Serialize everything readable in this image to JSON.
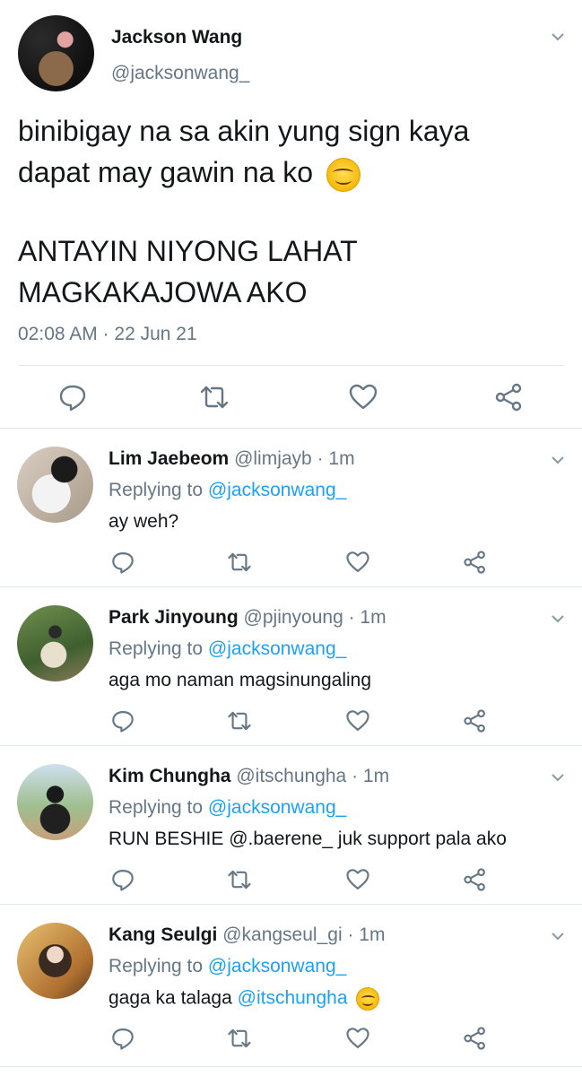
{
  "main_tweet": {
    "name": "Jackson Wang",
    "handle": "@jacksonwang_",
    "text_line1": "binibigay na sa akin yung sign kaya",
    "text_line2": "dapat may gawin na ko",
    "text_line3": "ANTAYIN NIYONG LAHAT",
    "text_line4": "MAGKAKAJOWA AKO",
    "timestamp": "02:08 AM · 22 Jun 21",
    "emoji": "smiling-face-emoji"
  },
  "replies": [
    {
      "name": "Lim Jaebeom",
      "meta": "@limjayb · 1m",
      "replying_prefix": "Replying to ",
      "replying_handle": "@jacksonwang_",
      "text": "ay weh?",
      "mention": "",
      "emoji": ""
    },
    {
      "name": "Park Jinyoung",
      "meta": "@pjinyoung · 1m",
      "replying_prefix": "Replying to ",
      "replying_handle": "@jacksonwang_",
      "text": "aga mo naman magsinungaling",
      "mention": "",
      "emoji": ""
    },
    {
      "name": "Kim Chungha",
      "meta": "@itschungha · 1m",
      "replying_prefix": "Replying to ",
      "replying_handle": "@jacksonwang_",
      "text": "RUN BESHIE @.baerene_ juk support pala ako",
      "mention": "",
      "emoji": ""
    },
    {
      "name": "Kang Seulgi",
      "meta": "@kangseul_gi · 1m",
      "replying_prefix": "Replying to ",
      "replying_handle": "@jacksonwang_",
      "text": "gaga ka talaga ",
      "mention": "@itschungha",
      "emoji": "laughing-face-emoji"
    }
  ],
  "colors": {
    "link": "#1da1f2",
    "secondary_text": "#657786",
    "primary_text": "#14171a",
    "divider": "#e1e8ed"
  },
  "icons": [
    "reply-icon",
    "retweet-icon",
    "like-icon",
    "share-icon",
    "chevron-down-icon"
  ]
}
